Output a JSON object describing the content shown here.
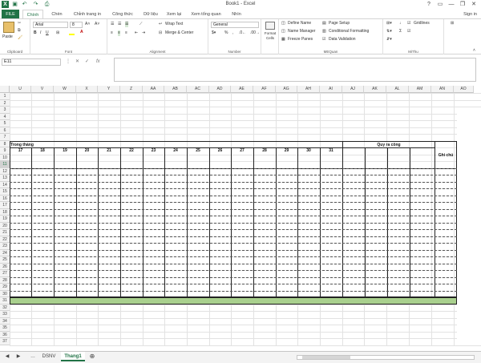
{
  "title": "Book1 - Excel",
  "window_controls": [
    "?",
    "▭",
    "—",
    "❐",
    "✕"
  ],
  "tabs": [
    "FILE",
    "Chính",
    "Chèn",
    "Chỉnh trang in",
    "Công thức",
    "Dữ liệu",
    "Xem lại",
    "Xem tổng quan",
    "Nhìn"
  ],
  "active_tab": "Chính",
  "signin": "Sign in",
  "ribbon": {
    "clipboard": {
      "paste": "Paste",
      "label": "Clipboard"
    },
    "font": {
      "family": "Arial",
      "size": "8",
      "label": "Font"
    },
    "alignment": {
      "wrap": "Wrap Text",
      "merge": "Merge & Center",
      "label": "Alignment"
    },
    "number": {
      "format": "General",
      "percent": "%",
      "comma": ",",
      "label": "Number"
    },
    "format_cells": "Format Cells",
    "mequan": {
      "define_name": "Define Name",
      "name_manager": "Name Manager",
      "freeze": "Freeze Panes",
      "page_setup": "Page Setup",
      "cond_format": "Conditional Formatting",
      "data_validation": "Data Validation",
      "label": "MEQuan"
    },
    "mithu": {
      "gridlines": "Gridlines",
      "label": "MiThu"
    }
  },
  "formula_bar": {
    "name_box": "E11",
    "fx": "fx",
    "value": ""
  },
  "columns": [
    "U",
    "V",
    "W",
    "X",
    "Y",
    "Z",
    "AA",
    "AB",
    "AC",
    "AD",
    "AE",
    "AF",
    "AG",
    "AH",
    "AI",
    "AJ",
    "AK",
    "AL",
    "AM",
    "AN",
    "AO"
  ],
  "rows": [
    "1",
    "2",
    "3",
    "4",
    "5",
    "6",
    "7",
    "8",
    "9",
    "10",
    "11",
    "12",
    "13",
    "14",
    "15",
    "16",
    "17",
    "18",
    "19",
    "20",
    "21",
    "22",
    "23",
    "24",
    "25",
    "26",
    "27",
    "28",
    "29",
    "30",
    "31",
    "32",
    "33",
    "34",
    "35",
    "36",
    "37"
  ],
  "selected_row": "11",
  "cells": {
    "trong_thang": "Trong tháng",
    "days": [
      "17",
      "18",
      "19",
      "20",
      "21",
      "22",
      "23",
      "24",
      "25",
      "26",
      "27",
      "28",
      "29",
      "30",
      "31"
    ],
    "quy_ra_cong": "Quy ra công",
    "ghi_chu": "Ghi chú"
  },
  "sheets": [
    "DSNV",
    "Thang1"
  ],
  "active_sheet": "Thang1",
  "colors": {
    "accent": "#217346",
    "green_row": "#a9d08e"
  }
}
